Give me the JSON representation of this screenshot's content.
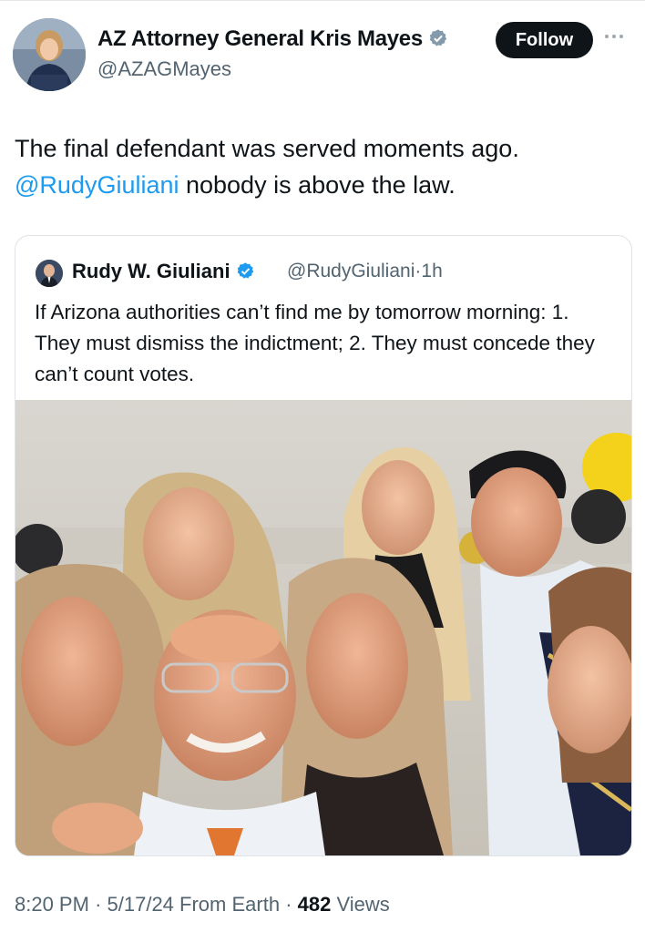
{
  "tweet": {
    "author_name": "AZ Attorney General Kris Mayes",
    "author_handle": "@AZAGMayes",
    "follow_label": "Follow",
    "text_line1": "The final defendant was served moments ago.",
    "mention": "@RudyGiuliani",
    "text_rest": " nobody is above the law."
  },
  "quote": {
    "name": "Rudy W. Giuliani",
    "handle": "@RudyGiuliani",
    "time": "1h",
    "separator": "·",
    "text": "If Arizona authorities can’t find me by tomorrow morning: 1. They must dismiss the indictment; 2. They must concede they can’t count votes."
  },
  "footer": {
    "time": "8:20 PM",
    "date": "5/17/24",
    "source": "From Earth",
    "views_count": "482",
    "views_label": "Views",
    "separator": "·"
  },
  "colors": {
    "link": "#1d9bf0",
    "verified": "#1d9bf0",
    "follow_bg": "#0f1419",
    "secondary_text": "#536471"
  },
  "icons": [
    "verified-badge-icon",
    "more-options-icon"
  ]
}
